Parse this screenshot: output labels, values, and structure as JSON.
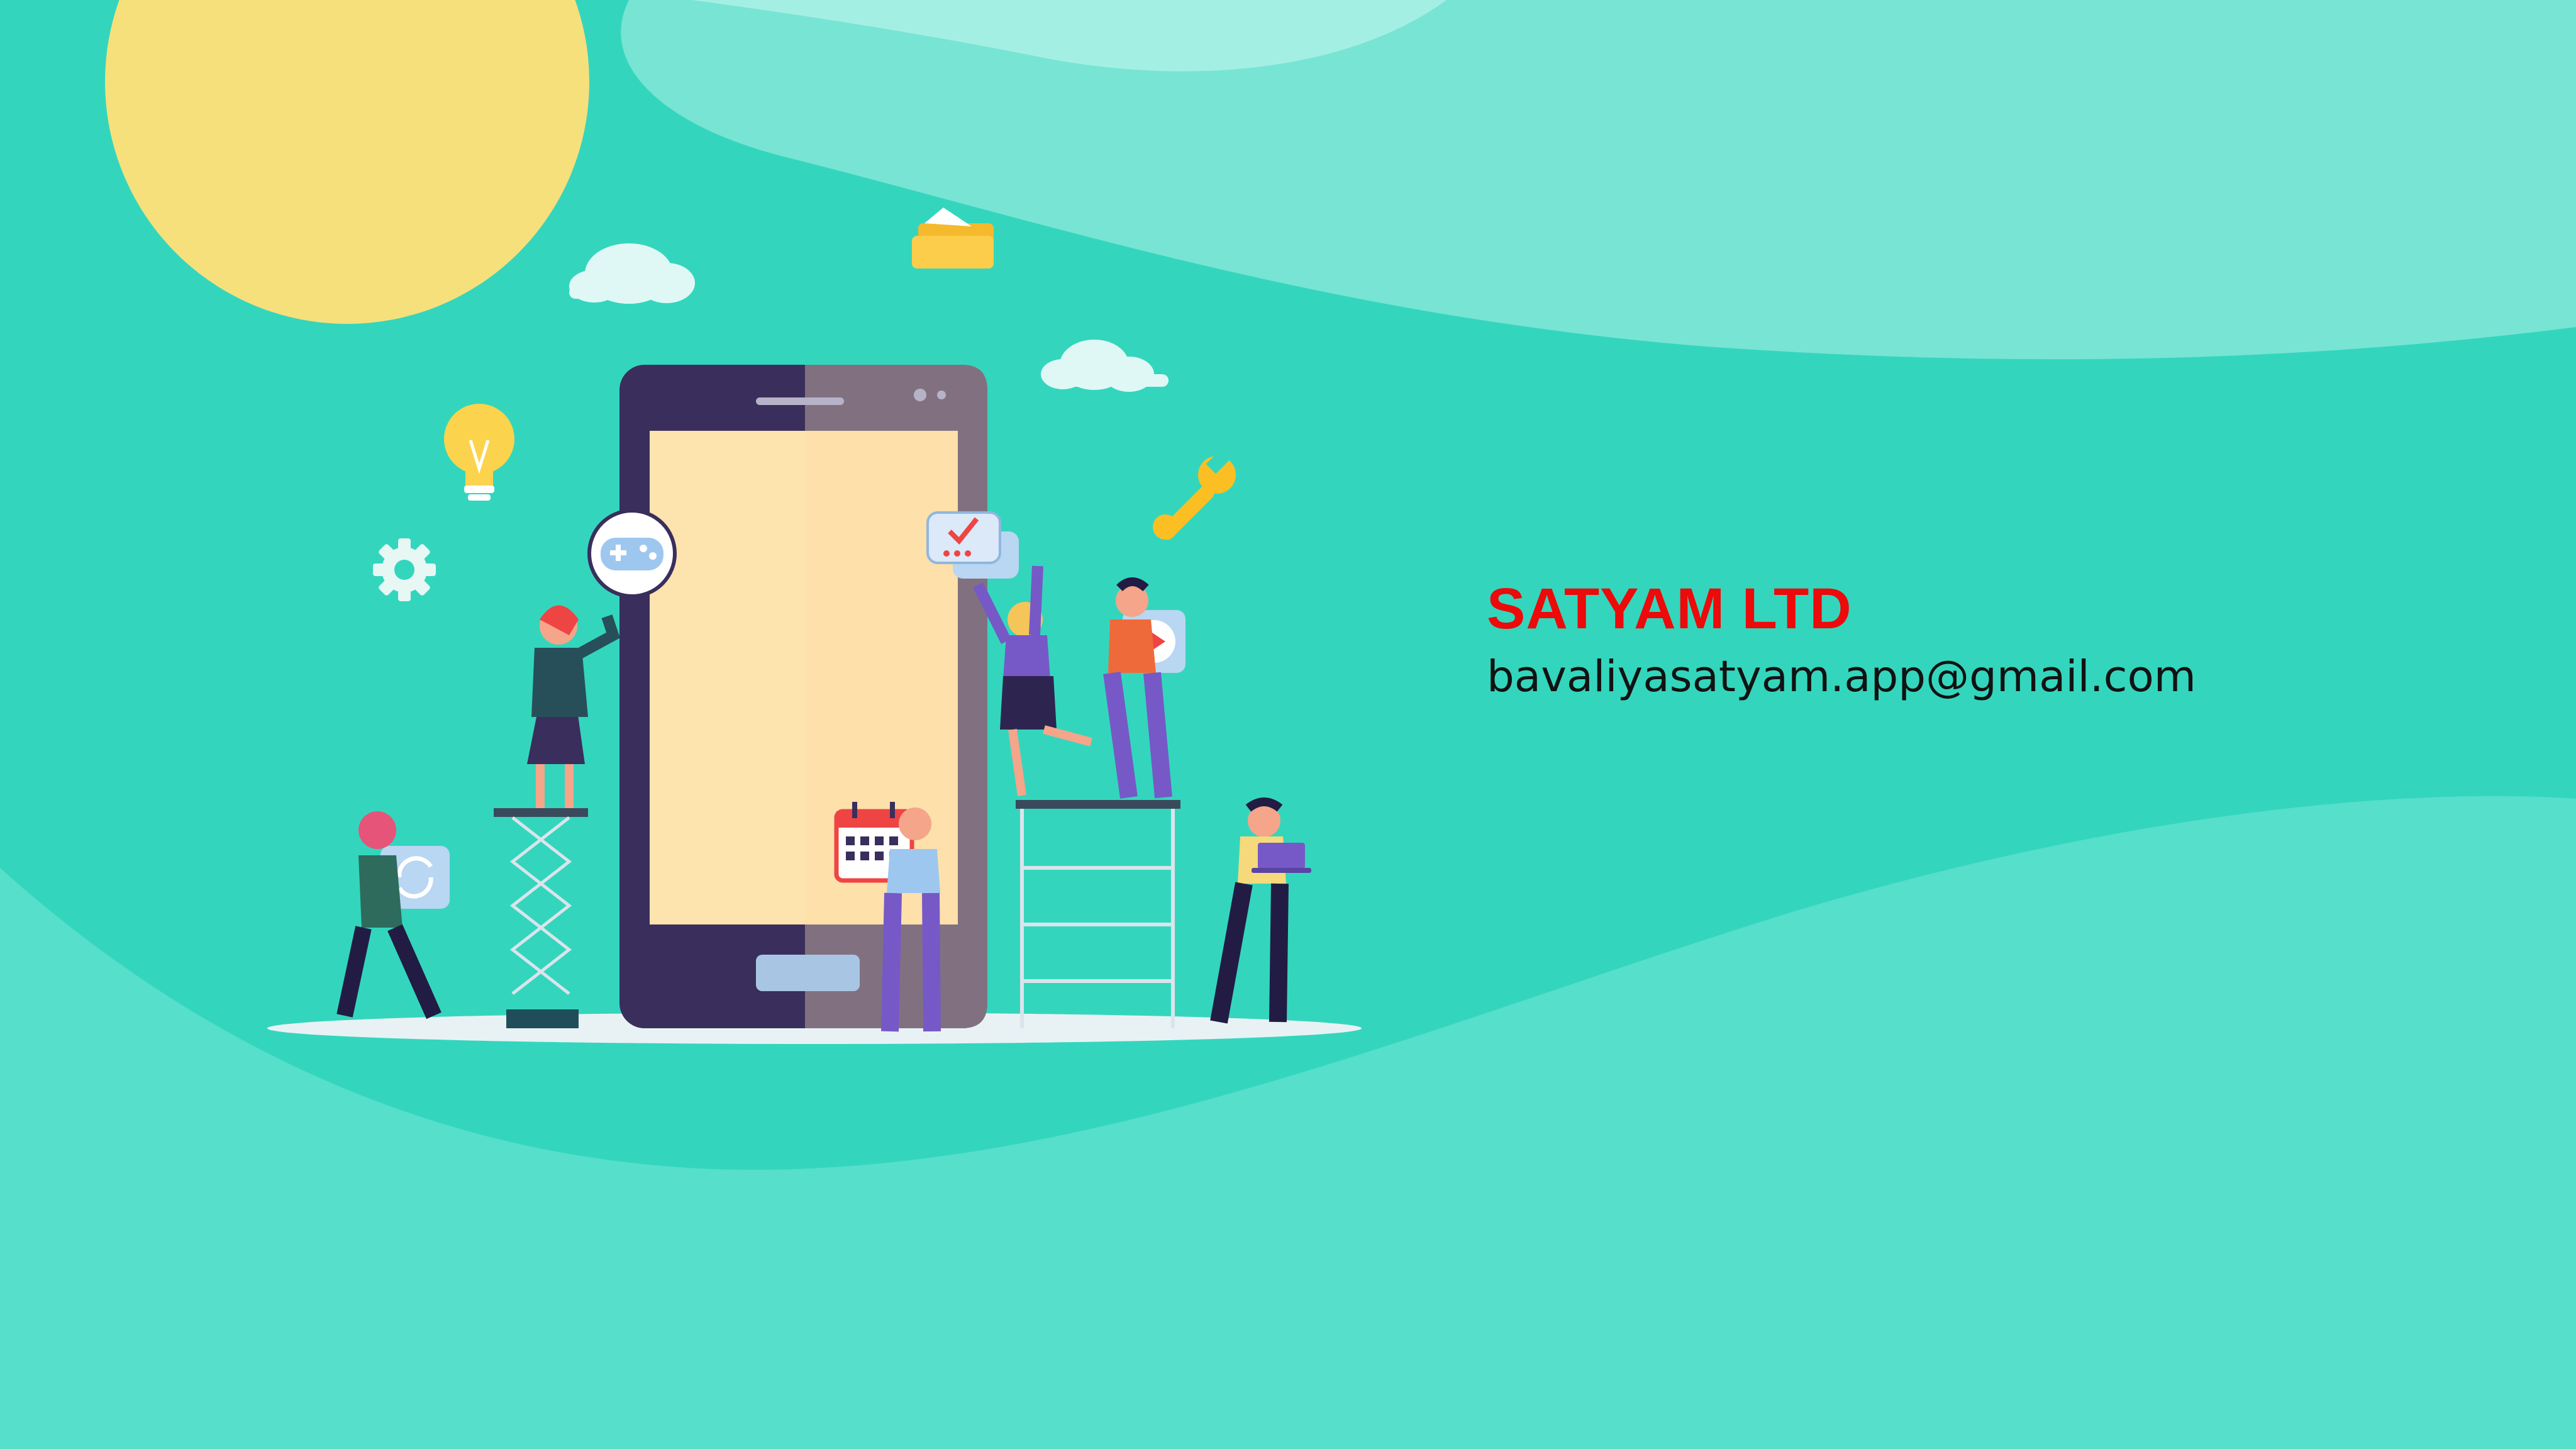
{
  "company": {
    "name": "SATYAM LTD",
    "email": "bavaliyasatyam.app@gmail.com"
  },
  "colors": {
    "background": "#33d6bd",
    "wave_light": "#7fe6d6",
    "wave_lighter": "#9eeee2",
    "wave_bottom": "#55dfca",
    "sun": "#f6e07c",
    "name_text": "#ec0a0a",
    "email_text": "#121212",
    "phone_frame": "#3a2e5c",
    "phone_screen": "#fde3ae"
  },
  "illustration": {
    "icons": [
      "sun",
      "cloud-icon",
      "folder-icon",
      "lightbulb-icon",
      "gear-icon",
      "wrench-icon",
      "gamepad-icon",
      "chat-check-icon",
      "play-icon",
      "calendar-icon",
      "sync-icon",
      "laptop-icon"
    ]
  }
}
